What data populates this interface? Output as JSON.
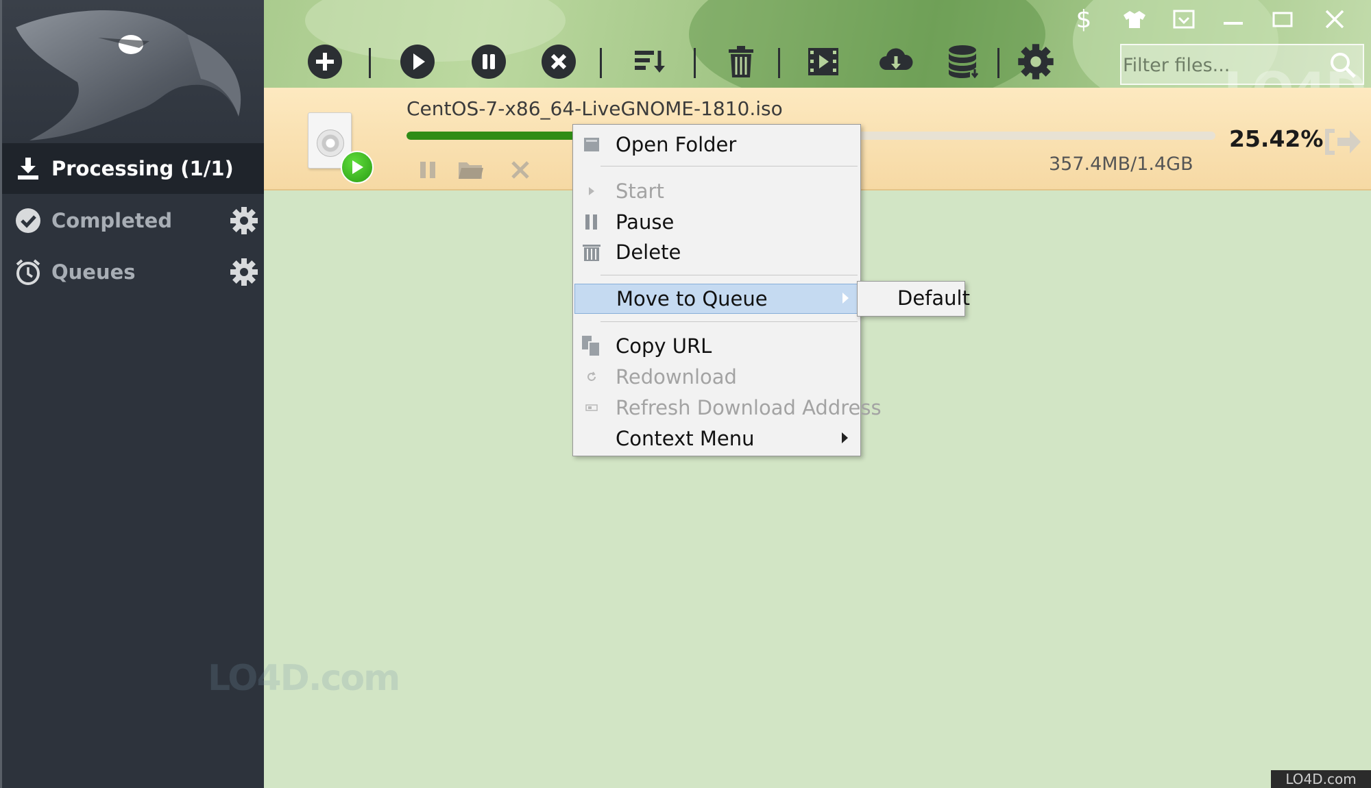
{
  "sidebar": {
    "items": [
      {
        "label": "Processing (1/1)",
        "active": true,
        "icon": "download-tray-icon"
      },
      {
        "label": "Completed",
        "active": false,
        "icon": "check-circle-icon",
        "has_settings": true
      },
      {
        "label": "Queues",
        "active": false,
        "icon": "alarm-clock-icon",
        "has_settings": true
      }
    ]
  },
  "toolbar": {
    "buttons": [
      "add-icon",
      "start-icon",
      "pause-icon",
      "stop-icon",
      "sort-icon",
      "delete-icon",
      "video-icon",
      "cloud-download-icon",
      "database-icon",
      "settings-icon"
    ],
    "filter_placeholder": "Filter files..."
  },
  "window_controls": [
    "dollar-icon",
    "skin-icon",
    "minimize-to-tray-icon",
    "minimize-icon",
    "maximize-icon",
    "close-icon"
  ],
  "download": {
    "file_name": "CentOS-7-x86_64-LiveGNOME-1810.iso",
    "progress": 0.2542,
    "percent_text": "25.42%",
    "size_text": "357.4MB/1.4GB"
  },
  "context_menu": {
    "items": [
      {
        "label": "Open Folder",
        "enabled": true,
        "icon": "folder-icon"
      },
      {
        "label": "Start",
        "enabled": false,
        "icon": "play-icon"
      },
      {
        "label": "Pause",
        "enabled": true,
        "icon": "pause-icon"
      },
      {
        "label": "Delete",
        "enabled": true,
        "icon": "trash-icon"
      },
      {
        "label": "Move to Queue",
        "enabled": true,
        "highlighted": true,
        "submenu": true
      },
      {
        "label": "Copy URL",
        "enabled": true,
        "icon": "copy-icon"
      },
      {
        "label": "Redownload",
        "enabled": false,
        "icon": "refresh-icon"
      },
      {
        "label": "Refresh Download Address",
        "enabled": false,
        "icon": "link-icon"
      },
      {
        "label": "Context Menu",
        "enabled": true,
        "submenu": true
      }
    ],
    "submenu_items": [
      "Default"
    ]
  },
  "watermarks": {
    "top": "LO4D.com",
    "sidebar": "LO4D.com",
    "corner": "LO4D.com"
  },
  "colors": {
    "sidebar_bg": "#2d333c",
    "content_bg": "#d2e5c5",
    "progress": "#2f8c16",
    "highlight": "#c5daf1"
  }
}
